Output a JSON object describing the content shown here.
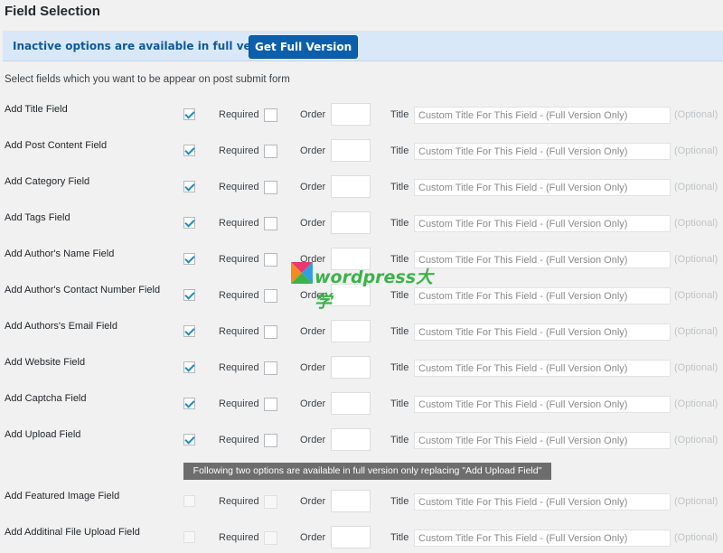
{
  "page": {
    "heading": "Field Selection",
    "notice_text": "Inactive options are available in full version.",
    "get_full_label": "Get Full Version",
    "intro": "Select fields which you want to be appear on post submit form",
    "tooltip": "Following two options are available in full version only replacing \"Add Upload Field\"",
    "watermark_text": "wordpress大学"
  },
  "labels": {
    "required": "Required",
    "order": "Order",
    "title": "Title",
    "placeholder": "Custom Title For This Field - (Full Version Only)",
    "optional": "(Optional)"
  },
  "colors": {
    "accent": "#0b5fad",
    "notice_bg": "#d9e8f8",
    "check": "#1e8cbe"
  },
  "fields": [
    {
      "label": "Add Title Field",
      "checked": true,
      "required": false,
      "enabled": true
    },
    {
      "label": "Add Post Content Field",
      "checked": true,
      "required": false,
      "enabled": true
    },
    {
      "label": "Add Category Field",
      "checked": true,
      "required": false,
      "enabled": true
    },
    {
      "label": "Add Tags Field",
      "checked": true,
      "required": false,
      "enabled": true
    },
    {
      "label": "Add Author's Name Field",
      "checked": true,
      "required": false,
      "enabled": true
    },
    {
      "label": "Add Author's Contact Number Field",
      "checked": true,
      "required": false,
      "enabled": true
    },
    {
      "label": "Add Authors's Email Field",
      "checked": true,
      "required": false,
      "enabled": true
    },
    {
      "label": "Add Website Field",
      "checked": true,
      "required": false,
      "enabled": true
    },
    {
      "label": "Add Captcha Field",
      "checked": true,
      "required": false,
      "enabled": true
    },
    {
      "label": "Add Upload Field",
      "checked": true,
      "required": false,
      "enabled": true
    },
    {
      "label": "Add Featured Image Field",
      "checked": false,
      "required": false,
      "enabled": false
    },
    {
      "label": "Add Additinal File Upload Field",
      "checked": false,
      "required": false,
      "enabled": false
    }
  ]
}
